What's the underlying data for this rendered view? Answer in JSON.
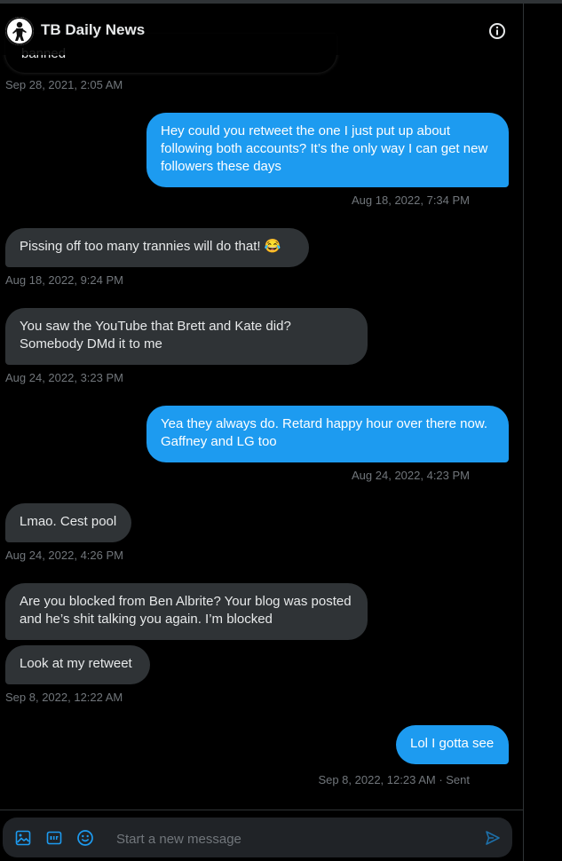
{
  "header": {
    "title": "TB Daily News"
  },
  "messages": [
    {
      "side": "received",
      "text": "banned",
      "time": "Sep 28, 2021, 2:05 AM"
    },
    {
      "side": "sent",
      "text": "Hey could you retweet the one I just put up about following both accounts? It’s the only way I can get new followers these days",
      "time": "Aug 18, 2022, 7:34 PM"
    },
    {
      "side": "received",
      "text": "Pissing off too many trannies will do that! 😂",
      "time": "Aug 18, 2022, 9:24 PM"
    },
    {
      "side": "received",
      "text": "You saw the YouTube that Brett and Kate did? Somebody DMd it to me",
      "time": "Aug 24, 2022, 3:23 PM"
    },
    {
      "side": "sent",
      "text": "Yea they always do. Retard happy hour over there now. Gaffney and LG too",
      "time": "Aug 24, 2022, 4:23 PM"
    },
    {
      "side": "received",
      "text": "Lmao. Cest pool",
      "time": "Aug 24, 2022, 4:26 PM"
    },
    {
      "side": "received",
      "text": "Are you blocked from Ben Albrite? Your blog was posted and he’s shit talking you again. I’m blocked",
      "time": ""
    },
    {
      "side": "received",
      "text": "Look at my retweet",
      "time": "Sep 8, 2022, 12:22 AM"
    },
    {
      "side": "sent",
      "text": "Lol I gotta see",
      "time": "Sep 8, 2022, 12:23 AM · Sent"
    }
  ],
  "composer": {
    "placeholder": "Start a new message"
  },
  "colors": {
    "accent": "#1d9bf0",
    "received_bubble": "#2f3336",
    "background": "#000000",
    "muted": "#71767b"
  }
}
